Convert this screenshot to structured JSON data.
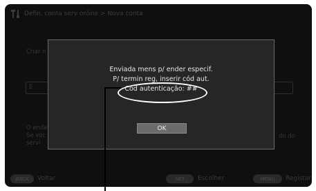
{
  "header": {
    "title": "Defin. conta serv online > Nova conta",
    "icon": "settings-tools-icon"
  },
  "background": {
    "line1": "Criar n",
    "field_char": "E",
    "line2a": "O ender",
    "line2b": "Se voc",
    "line2c": "servi",
    "line_right": "do do"
  },
  "dialog": {
    "line1": "Enviada mens p/ ender especif.",
    "line2": "P/ termin reg, inserir cód aut.",
    "line3": "Cód autenticação: ##",
    "ok_label": "OK"
  },
  "footer": {
    "back_key": "BACK",
    "back_label": "Voltar",
    "set_key": "SET",
    "set_label": "Escolher",
    "menu_key": "MENU",
    "menu_label": "Registar"
  },
  "colors": {
    "screen_bg": "#0f0f0f",
    "dialog_bg": "#262626",
    "ok_button": "#6b6b6b",
    "callout": "#ffffff"
  }
}
